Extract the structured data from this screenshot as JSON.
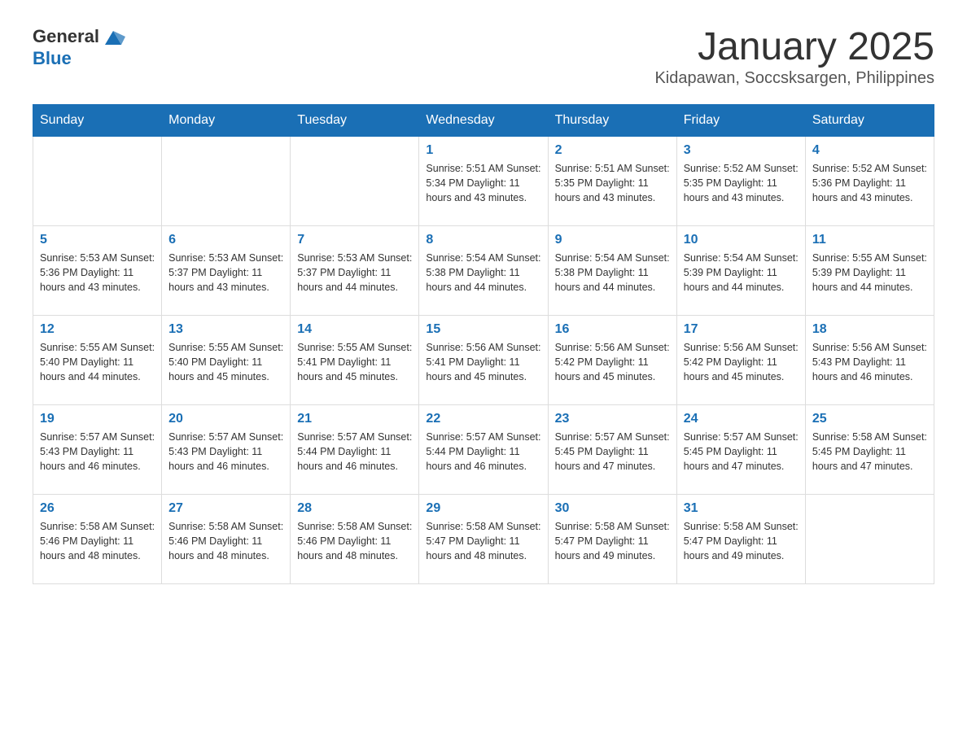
{
  "header": {
    "logo_general": "General",
    "logo_blue": "Blue",
    "month_title": "January 2025",
    "location": "Kidapawan, Soccsksargen, Philippines"
  },
  "days_of_week": [
    "Sunday",
    "Monday",
    "Tuesday",
    "Wednesday",
    "Thursday",
    "Friday",
    "Saturday"
  ],
  "weeks": [
    [
      {
        "day": "",
        "info": ""
      },
      {
        "day": "",
        "info": ""
      },
      {
        "day": "",
        "info": ""
      },
      {
        "day": "1",
        "info": "Sunrise: 5:51 AM\nSunset: 5:34 PM\nDaylight: 11 hours and 43 minutes."
      },
      {
        "day": "2",
        "info": "Sunrise: 5:51 AM\nSunset: 5:35 PM\nDaylight: 11 hours and 43 minutes."
      },
      {
        "day": "3",
        "info": "Sunrise: 5:52 AM\nSunset: 5:35 PM\nDaylight: 11 hours and 43 minutes."
      },
      {
        "day": "4",
        "info": "Sunrise: 5:52 AM\nSunset: 5:36 PM\nDaylight: 11 hours and 43 minutes."
      }
    ],
    [
      {
        "day": "5",
        "info": "Sunrise: 5:53 AM\nSunset: 5:36 PM\nDaylight: 11 hours and 43 minutes."
      },
      {
        "day": "6",
        "info": "Sunrise: 5:53 AM\nSunset: 5:37 PM\nDaylight: 11 hours and 43 minutes."
      },
      {
        "day": "7",
        "info": "Sunrise: 5:53 AM\nSunset: 5:37 PM\nDaylight: 11 hours and 44 minutes."
      },
      {
        "day": "8",
        "info": "Sunrise: 5:54 AM\nSunset: 5:38 PM\nDaylight: 11 hours and 44 minutes."
      },
      {
        "day": "9",
        "info": "Sunrise: 5:54 AM\nSunset: 5:38 PM\nDaylight: 11 hours and 44 minutes."
      },
      {
        "day": "10",
        "info": "Sunrise: 5:54 AM\nSunset: 5:39 PM\nDaylight: 11 hours and 44 minutes."
      },
      {
        "day": "11",
        "info": "Sunrise: 5:55 AM\nSunset: 5:39 PM\nDaylight: 11 hours and 44 minutes."
      }
    ],
    [
      {
        "day": "12",
        "info": "Sunrise: 5:55 AM\nSunset: 5:40 PM\nDaylight: 11 hours and 44 minutes."
      },
      {
        "day": "13",
        "info": "Sunrise: 5:55 AM\nSunset: 5:40 PM\nDaylight: 11 hours and 45 minutes."
      },
      {
        "day": "14",
        "info": "Sunrise: 5:55 AM\nSunset: 5:41 PM\nDaylight: 11 hours and 45 minutes."
      },
      {
        "day": "15",
        "info": "Sunrise: 5:56 AM\nSunset: 5:41 PM\nDaylight: 11 hours and 45 minutes."
      },
      {
        "day": "16",
        "info": "Sunrise: 5:56 AM\nSunset: 5:42 PM\nDaylight: 11 hours and 45 minutes."
      },
      {
        "day": "17",
        "info": "Sunrise: 5:56 AM\nSunset: 5:42 PM\nDaylight: 11 hours and 45 minutes."
      },
      {
        "day": "18",
        "info": "Sunrise: 5:56 AM\nSunset: 5:43 PM\nDaylight: 11 hours and 46 minutes."
      }
    ],
    [
      {
        "day": "19",
        "info": "Sunrise: 5:57 AM\nSunset: 5:43 PM\nDaylight: 11 hours and 46 minutes."
      },
      {
        "day": "20",
        "info": "Sunrise: 5:57 AM\nSunset: 5:43 PM\nDaylight: 11 hours and 46 minutes."
      },
      {
        "day": "21",
        "info": "Sunrise: 5:57 AM\nSunset: 5:44 PM\nDaylight: 11 hours and 46 minutes."
      },
      {
        "day": "22",
        "info": "Sunrise: 5:57 AM\nSunset: 5:44 PM\nDaylight: 11 hours and 46 minutes."
      },
      {
        "day": "23",
        "info": "Sunrise: 5:57 AM\nSunset: 5:45 PM\nDaylight: 11 hours and 47 minutes."
      },
      {
        "day": "24",
        "info": "Sunrise: 5:57 AM\nSunset: 5:45 PM\nDaylight: 11 hours and 47 minutes."
      },
      {
        "day": "25",
        "info": "Sunrise: 5:58 AM\nSunset: 5:45 PM\nDaylight: 11 hours and 47 minutes."
      }
    ],
    [
      {
        "day": "26",
        "info": "Sunrise: 5:58 AM\nSunset: 5:46 PM\nDaylight: 11 hours and 48 minutes."
      },
      {
        "day": "27",
        "info": "Sunrise: 5:58 AM\nSunset: 5:46 PM\nDaylight: 11 hours and 48 minutes."
      },
      {
        "day": "28",
        "info": "Sunrise: 5:58 AM\nSunset: 5:46 PM\nDaylight: 11 hours and 48 minutes."
      },
      {
        "day": "29",
        "info": "Sunrise: 5:58 AM\nSunset: 5:47 PM\nDaylight: 11 hours and 48 minutes."
      },
      {
        "day": "30",
        "info": "Sunrise: 5:58 AM\nSunset: 5:47 PM\nDaylight: 11 hours and 49 minutes."
      },
      {
        "day": "31",
        "info": "Sunrise: 5:58 AM\nSunset: 5:47 PM\nDaylight: 11 hours and 49 minutes."
      },
      {
        "day": "",
        "info": ""
      }
    ]
  ]
}
